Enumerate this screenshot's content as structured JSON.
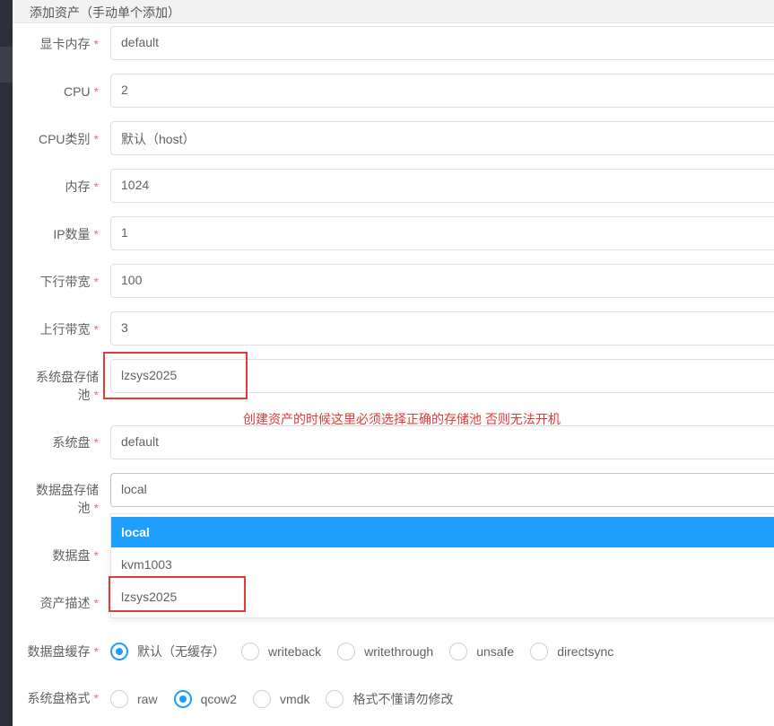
{
  "header": {
    "title": "添加资产（手动单个添加）"
  },
  "form": {
    "gpu_mem": {
      "label": "显卡内存",
      "value": "default"
    },
    "cpu": {
      "label": "CPU",
      "value": "2"
    },
    "cpu_type": {
      "label": "CPU类别",
      "value": "默认（host）"
    },
    "memory": {
      "label": "内存",
      "value": "1024"
    },
    "ip_count": {
      "label": "IP数量",
      "value": "1"
    },
    "down_bw": {
      "label": "下行带宽",
      "value": "100"
    },
    "up_bw": {
      "label": "上行带宽",
      "value": "3"
    },
    "sys_pool": {
      "label_line1": "系统盘存储",
      "label_line2": "池",
      "value": "lzsys2025"
    },
    "sys_disk": {
      "label": "系统盘",
      "value": "default"
    },
    "data_pool": {
      "label_line1": "数据盘存储",
      "label_line2": "池",
      "value": "local"
    },
    "data_disk": {
      "label": "数据盘"
    },
    "asset_desc": {
      "label": "资产描述"
    },
    "required_mark": "*"
  },
  "annotation": {
    "text": "创建资产的时候这里必须选择正确的存储池  否则无法开机"
  },
  "dropdown": {
    "options": [
      "local",
      "kvm1003",
      "lzsys2025"
    ],
    "selected": "local"
  },
  "data_cache": {
    "label": "数据盘缓存",
    "options": [
      "默认（无缓存）",
      "writeback",
      "writethrough",
      "unsafe",
      "directsync"
    ],
    "selected": "默认（无缓存）"
  },
  "sys_format": {
    "label": "系统盘格式",
    "options": [
      "raw",
      "qcow2",
      "vmdk",
      "格式不懂请勿修改"
    ],
    "selected": "qcow2"
  },
  "colors": {
    "accent": "#1e9fff",
    "required": "#f56c6c",
    "annotation": "#e53935"
  }
}
